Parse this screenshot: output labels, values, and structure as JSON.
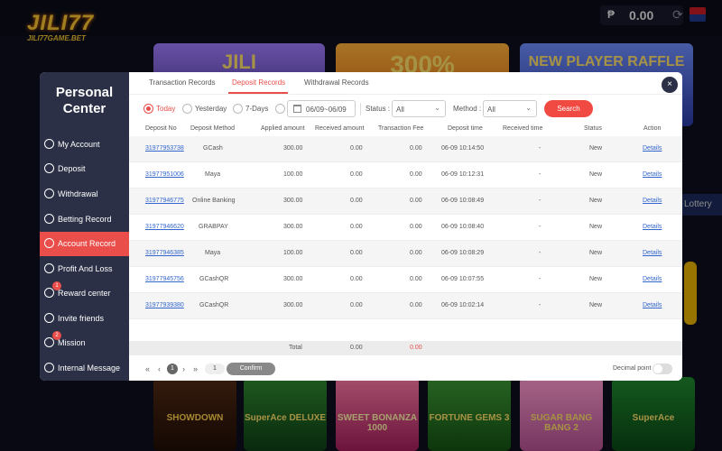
{
  "site": {
    "logo": "JILI77",
    "logo_sub": "JILI77GAME.BET",
    "currency": "₱",
    "balance": "0.00",
    "banners": [
      "JILI",
      "300%",
      "NEW PLAYER RAFFLE"
    ],
    "lottery": "Lottery",
    "games": [
      "SHOWDOWN",
      "SuperAce DELUXE",
      "SWEET BONANZA 1000",
      "FORTUNE GEMS 3",
      "SUGAR BANG BANG 2",
      "SuperAce"
    ]
  },
  "sidebar": {
    "title": "Personal Center",
    "items": [
      {
        "label": "My Account",
        "icon": "user-icon"
      },
      {
        "label": "Deposit",
        "icon": "deposit-icon"
      },
      {
        "label": "Withdrawal",
        "icon": "withdrawal-icon"
      },
      {
        "label": "Betting Record",
        "icon": "record-icon"
      },
      {
        "label": "Account Record",
        "icon": "account-record-icon",
        "active": true
      },
      {
        "label": "Profit And Loss",
        "icon": "profit-icon"
      },
      {
        "label": "Reward center",
        "icon": "reward-icon",
        "badge": "1"
      },
      {
        "label": "Invite friends",
        "icon": "invite-icon"
      },
      {
        "label": "Mission",
        "icon": "mission-icon",
        "badge": "2"
      },
      {
        "label": "Internal Message",
        "icon": "message-icon"
      }
    ]
  },
  "tabs": [
    "Transaction Records",
    "Deposit Records",
    "Withdrawal Records"
  ],
  "filters": {
    "ranges": [
      "Today",
      "Yesterday",
      "7-Days"
    ],
    "date_range": "06/09~06/09",
    "status_label": "Status :",
    "status_value": "All",
    "method_label": "Method :",
    "method_value": "All",
    "search_label": "Search"
  },
  "table": {
    "headers": [
      "Deposit No",
      "Deposit Method",
      "Applied amount",
      "Received amount",
      "Transaction Fee",
      "Deposit time",
      "Received time",
      "Status",
      "Action"
    ],
    "rows": [
      {
        "no": "31977953738",
        "method": "GCash",
        "applied": "300.00",
        "received": "0.00",
        "fee": "0.00",
        "dtime": "06-09 10:14:50",
        "rtime": "-",
        "status": "New",
        "action": "Details"
      },
      {
        "no": "31977951006",
        "method": "Maya",
        "applied": "100.00",
        "received": "0.00",
        "fee": "0.00",
        "dtime": "06-09 10:12:31",
        "rtime": "-",
        "status": "New",
        "action": "Details"
      },
      {
        "no": "31977946775",
        "method": "Online Banking",
        "applied": "300.00",
        "received": "0.00",
        "fee": "0.00",
        "dtime": "06-09 10:08:49",
        "rtime": "-",
        "status": "New",
        "action": "Details"
      },
      {
        "no": "31977946620",
        "method": "GRABPAY",
        "applied": "300.00",
        "received": "0.00",
        "fee": "0.00",
        "dtime": "06-09 10:08:40",
        "rtime": "-",
        "status": "New",
        "action": "Details"
      },
      {
        "no": "31977946385",
        "method": "Maya",
        "applied": "100.00",
        "received": "0.00",
        "fee": "0.00",
        "dtime": "06-09 10:08:29",
        "rtime": "-",
        "status": "New",
        "action": "Details"
      },
      {
        "no": "31977945756",
        "method": "GCashQR",
        "applied": "300.00",
        "received": "0.00",
        "fee": "0.00",
        "dtime": "06-09 10:07:55",
        "rtime": "-",
        "status": "New",
        "action": "Details"
      },
      {
        "no": "31977939380",
        "method": "GCashQR",
        "applied": "300.00",
        "received": "0.00",
        "fee": "0.00",
        "dtime": "06-09 10:02:14",
        "rtime": "-",
        "status": "New",
        "action": "Details"
      }
    ],
    "total_label": "Total",
    "total_received": "0.00",
    "total_fee": "0.00"
  },
  "pager": {
    "first": "«",
    "prev": "‹",
    "page": "1",
    "next": "›",
    "last": "»",
    "input_value": "1",
    "confirm_label": "Confirm",
    "decimal_label": "Decimal point"
  },
  "close_label": "×"
}
